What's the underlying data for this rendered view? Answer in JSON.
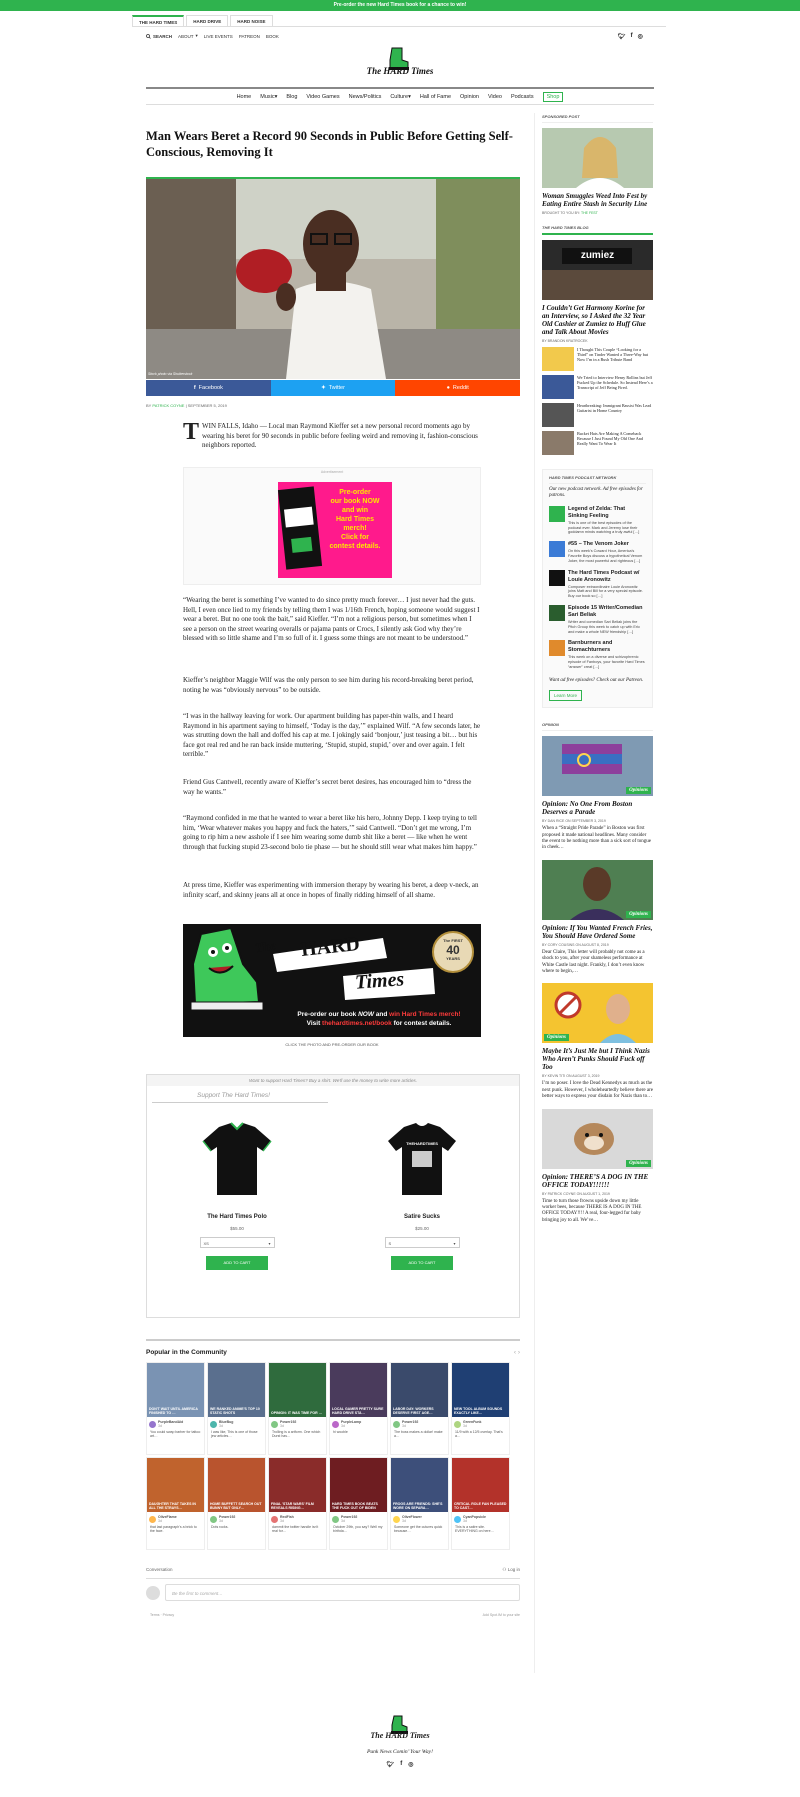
{
  "announcement": "Pre-order the new Hard Times book for a chance to win!",
  "site_tabs": [
    "THE HARD TIMES",
    "HARD DRIVE",
    "HARD NOISE"
  ],
  "utility": {
    "search": "SEARCH",
    "about": "ABOUT",
    "live_events": "LIVE EVENTS",
    "patreon": "PATREON",
    "book": "BOOK"
  },
  "logo": {
    "the": "The",
    "name": "HARD Times"
  },
  "nav": [
    "Home",
    "Music",
    "Blog",
    "Video Games",
    "News/Politics",
    "Culture",
    "Hall of Fame",
    "Opinion",
    "Video",
    "Podcasts",
    "Shop"
  ],
  "article": {
    "title": "Man Wears Beret a Record 90 Seconds in Public Before Getting Self-Conscious, Removing It",
    "photo_credit": "Stock photo via Shutterstock",
    "share": [
      "Facebook",
      "Twitter",
      "Reddit"
    ],
    "byline_prefix": "BY",
    "author": "PATRICK COYNE",
    "date": "SEPTEMBER 5, 2019",
    "dropcap": "T",
    "p1": "WIN FALLS, Idaho — Local man Raymond Kieffer set a new personal record moments ago by wearing his beret for 90 seconds in public before feeling weird and removing it, fashion-conscious neighbors reported.",
    "ad_label": "Advertisement",
    "ad_text": [
      "Pre-order",
      "our book NOW",
      "and win",
      "Hard Times",
      "merch!",
      "Click for",
      "contest details."
    ],
    "p2": "“Wearing the beret is something I’ve wanted to do since pretty much forever… I just never had the guts. Hell, I even once lied to my friends by telling them I was 1/16th French, hoping someone would suggest I wear a beret. But no one took the bait,” said Kieffer. “I’m not a religious person, but sometimes when I see a person on the street wearing overalls or pajama pants or Crocs, I silently ask God why they’re blessed with so little shame and I’m so full of it. I guess some things are not meant to be understood.”",
    "p3": "Kieffer’s neighbor Maggie Wilf was the only person to see him during his record-breaking beret period, noting he was “obviously nervous” to be outside.",
    "p4": "“I was in the hallway leaving for work. Our apartment building has paper-thin walls, and I heard Raymond in his apartment saying to himself, ‘Today is the day,’” explained Wilf. “A few seconds later, he was strutting down the hall and doffed his cap at me. I jokingly said ‘bonjour,’ just teasing a bit… but his face got real red and he ran back inside muttering, ‘Stupid, stupid, stupid,’ over and over again. I felt terrible.”",
    "p5": "Friend Gus Cantwell, recently aware of Kieffer’s secret beret desires, has encouraged him to “dress the way he wants.”",
    "p6": "“Raymond confided in me that he wanted to wear a beret like his hero, Johnny Depp. I keep trying to tell him, ‘Wear whatever makes you happy and fuck the haters,’” said Cantwell. “Don’t get me wrong, I’m going to rip him a new asshole if I see him wearing some dumb shit like a beret — like when he went through that fucking stupid 23-second bolo tie phase — but he should still wear what makes him happy.”",
    "p7": "At press time, Kieffer was experimenting with immersion therapy by wearing his beret, a deep v-neck, an infinity scarf, and skinny jeans all at once in hopes of finally ridding himself of all shame.",
    "big_ad": {
      "the": "The",
      "hard": "HARD",
      "times": "Times",
      "first": "The FIRST",
      "forty": "40",
      "years": "YEARS",
      "line1a": "Pre-order our book ",
      "now": "NOW",
      "line1b": " and ",
      "win": "win Hard Times merch!",
      "line2a": "Visit ",
      "url": "thehardtimes.net/book",
      "line2b": " for contest details."
    },
    "big_ad_caption": "CLICK THE PHOTO AND PRE-ORDER OUR BOOK"
  },
  "shop": {
    "note": "Want to support Hard Times? Buy a shirt. We'll use the money to write more articles.",
    "heading": "Support The Hard Times!",
    "products": [
      {
        "name": "The Hard Times Polo",
        "price": "$55.00",
        "size": "XS",
        "button": "ADD TO CART",
        "shirt_text": ""
      },
      {
        "name": "Satire Sucks",
        "price": "$25.00",
        "size": "S",
        "button": "ADD TO CART",
        "shirt_text": "THEHARDTIMES"
      }
    ]
  },
  "popular": {
    "title": "Popular in the Community",
    "cards": [
      {
        "headline": "DON'T WAIT UNTIL AMERICA FINISHED TO …",
        "user": "PurpleBandAid",
        "time": "3d",
        "text": "You could swap barber for tattoo art…",
        "thumb": "#7a93b3",
        "av": "#9575cd"
      },
      {
        "headline": "WE RANKED ANIME'S TOP 10 STATIC SHOTS",
        "user": "BlueBug",
        "time": "3d",
        "text": "I was like, This is one of those jew articles…",
        "thumb": "#5a6f8e",
        "av": "#4db6ac"
      },
      {
        "headline": "OPINION: IT WAS TIME FOR …",
        "user": "Power192",
        "time": "3d",
        "text": "Trolling is a artform. One which Durst has…",
        "thumb": "#2f6b3d",
        "av": "#81c784"
      },
      {
        "headline": "LOCAL GAMER PRETTY SURE HARD DRIVE STA…",
        "user": "PurpleLamp",
        "time": "3d",
        "text": "hi wooble",
        "thumb": "#4a3b5c",
        "av": "#ba68c8"
      },
      {
        "headline": "LABOR DAY: WORKERS DESERVE FIRST AGE…",
        "user": "Power192",
        "time": "3d",
        "text": "The boss makes a dollar! make a…",
        "thumb": "#3a4a6b",
        "av": "#81c784"
      },
      {
        "headline": "NEW TOOL ALBUM SOUNDS EXACTLY LIKE…",
        "user": "GreenFunk",
        "time": "3d",
        "text": "11/9 with a 12/5 overlay. That's a…",
        "thumb": "#1f3f73",
        "av": "#aed581"
      },
      {
        "headline": "DAUGHTER THAT TAKES IN ALL THE STRAYS…",
        "user": "OliveFlame",
        "time": "3d",
        "text": "that last paragraph's a brick to the face.",
        "thumb": "#c0632d",
        "av": "#ffb74d"
      },
      {
        "headline": "HOME BUFFETT SEARCH OUT BUNNY BUT ONLY…",
        "user": "Power192",
        "time": "3d",
        "text": "Dots rocks.",
        "thumb": "#b9542e",
        "av": "#81c784"
      },
      {
        "headline": "FINAL 'STAR WARS' FILM REVEALS RISING…",
        "user": "RedFish",
        "time": "3d",
        "text": "dammit the twitter handle isn't real for…",
        "thumb": "#8a2c2a",
        "av": "#e57373"
      },
      {
        "headline": "HARD TIMES BOOK BEATS THE FUCK OUT OF BIDEN",
        "user": "Power192",
        "time": "3d",
        "text": "October 29th, you say? Well my birthda…",
        "thumb": "#6e1d21",
        "av": "#81c784"
      },
      {
        "headline": "FROGS ARE FRIENDS: SHE'S WORE ON SEPARA…",
        "user": "OliveFlower",
        "time": "3d",
        "text": "Someone get the cutures quick because…",
        "thumb": "#3d4f7a",
        "av": "#ffd54f"
      },
      {
        "headline": "CRITICAL ROLE FAN PLEASED TO CAST…",
        "user": "CyanPopsicle",
        "time": "3d",
        "text": "This is a satire site. EVERYTHING on here…",
        "thumb": "#b3322a",
        "av": "#4fc3f7"
      }
    ]
  },
  "conversation": {
    "title": "Conversation",
    "login": "Log in",
    "placeholder": "Be the first to comment…",
    "terms": "Terms",
    "privacy": "Privacy",
    "spot": "Add Spot.IM to your site"
  },
  "sidebar": {
    "sponsored_label": "SPONSORED POST",
    "sponsored_title": "Woman Smuggles Weed Into Fest by Eating Entire Stash in Security Line",
    "sponsored_meta": "BROUGHT TO YOU BY:",
    "sponsored_sponsor": "THE FEST",
    "blog_label": "THE HARD TIMES BLOG",
    "blog_img_text": "zumiez",
    "blog_title": "I Couldn’t Get Harmony Korine for an Interview, so I Asked the 32 Year Old Cashier at Zumiez to Huff Glue and Talk About Movies",
    "blog_author": "BY BRANDON KRATROCEK",
    "blog_minis": [
      "I Thought This Couple “Looking for a Third” on Tinder Wanted a Three-Way but Now I’m in a Bush Tribute Band",
      "We Tried to Interview Henry Rollins but Jeff Fucked Up the Schedule. So Instead Here’s a Transcript of Jeff Being Fired.",
      "Heartbreaking: Immigrant Bassist Was Lead Guitarist in Home Country",
      "Bucket Hats Are Making A Comeback Because I Just Found My Old One And Really Want To Wear It"
    ],
    "podcast_label": "HARD TIMES PODCAST NETWORK",
    "podcast_intro": "Our new podcast network. Ad free episodes for patrons.",
    "podcasts": [
      {
        "title": "Legend of Zelda: That Sinking Feeling",
        "desc": "This is one of the best episodes of the podcast ever. Mark and Jeremy lose their goddamn minds watching a truly awful […]"
      },
      {
        "title": "#55 – The Venom Joker",
        "desc": "On this week’s Coward Hour, America’s Favorite Boys discuss a hypothetical Venom Joker, the most powerful and righteous […]"
      },
      {
        "title": "The Hard Times Podcast w/ Louie Aronowitz",
        "desc": "Composer extraordinaire Louie Aronowitz joins Matt and Bill for a very special episode. Buy our book so […]"
      },
      {
        "title": "Episode 15 Writer/Comedian Sari Beliak",
        "desc": "Writer and comedian Sari Beliak joins the Pitch Group this week to catch up with Eric and make a whole NEW friendship […]"
      },
      {
        "title": "Barnburners and Stomachturners",
        "desc": "This week on a diverse and schizophrenic episode of Fanboys, your favorite Hard Times “answer” creat […]"
      }
    ],
    "podcast_outro": "Want ad free episodes? Check out our Patreon.",
    "learn_more": "Learn More",
    "opinion_label": "OPINION",
    "opinion_badge": "Opinions",
    "opinions": [
      {
        "title": "Opinion: No One From Boston Deserves a Parade",
        "by": "BY",
        "author": "DAN RICE",
        "date": "ON SEPTEMBER 3, 2019",
        "text": "When a “Straight Pride Parade” in Boston was first proposed it made national headlines. Many consider the event to be nothing more than a sick sort of tongue in cheek…"
      },
      {
        "title": "Opinion: If You Wanted French Fries, You Should Have Ordered Some",
        "by": "BY",
        "author": "CORY COUSINS",
        "date": "ON AUGUST 8, 2019",
        "text": "Dear Claire, This letter will probably not come as a shock to you, after your shameless performance at White Castle last night. Frankly, I don’t even know where to begin,…"
      },
      {
        "title": "Maybe It’s Just Me but I Think Nazis Who Aren’t Punks Should Fuck off Too",
        "by": "BY",
        "author": "KEVIN TITI",
        "date": "ON AUGUST 3, 2019",
        "text": "I’m no poser. I love the Dead Kennedys as much as the next punk. However, I wholeheartedly believe there are better ways to express your disdain for Nazis than to…"
      },
      {
        "title": "Opinion: THERE’S A DOG IN THE OFFICE TODAY!!!!!!",
        "by": "BY",
        "author": "PATRICK COYNE",
        "date": "ON AUGUST 1, 2019",
        "text": "Time to turn those frowns upside down my little worker bees, because THERE IS A DOG IN THE OFFICE TODAY!!!! A real, four-legged fur baby bringing joy to all. We’ve…"
      }
    ]
  },
  "footer": {
    "tagline": "Punk News Comin’ Your Way!"
  },
  "colors": {
    "brand_green": "#2fb34e",
    "facebook": "#3b5998",
    "twitter": "#1da1f2",
    "reddit": "#ff4500"
  }
}
